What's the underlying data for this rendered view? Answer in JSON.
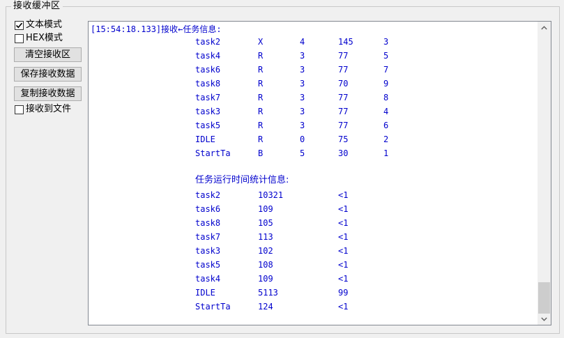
{
  "groupbox": {
    "title": "接收缓冲区"
  },
  "options": {
    "text_mode": {
      "label": "文本模式",
      "checked": true
    },
    "hex_mode": {
      "label": "HEX模式",
      "checked": false
    },
    "recv_to_file": {
      "label": "接收到文件",
      "checked": false
    }
  },
  "buttons": {
    "clear": "清空接收区",
    "save": "保存接收数据",
    "copy": "复制接收数据"
  },
  "receive": {
    "header": "[15:54:18.133]接收←任务信息:",
    "task_rows": [
      [
        "task2",
        "X",
        "4",
        "145",
        "3"
      ],
      [
        "task4",
        "R",
        "3",
        "77",
        "5"
      ],
      [
        "task6",
        "R",
        "3",
        "77",
        "7"
      ],
      [
        "task8",
        "R",
        "3",
        "70",
        "9"
      ],
      [
        "task7",
        "R",
        "3",
        "77",
        "8"
      ],
      [
        "task3",
        "R",
        "3",
        "77",
        "4"
      ],
      [
        "task5",
        "R",
        "3",
        "77",
        "6"
      ],
      [
        "IDLE",
        "R",
        "0",
        "75",
        "2"
      ],
      [
        "StartTa",
        "B",
        "5",
        "30",
        "1"
      ]
    ],
    "stats_header": "任务运行时间统计信息:",
    "stats_rows": [
      [
        "task2",
        "10321",
        "<1"
      ],
      [
        "task6",
        "109",
        "<1"
      ],
      [
        "task8",
        "105",
        "<1"
      ],
      [
        "task7",
        "113",
        "<1"
      ],
      [
        "task3",
        "102",
        "<1"
      ],
      [
        "task5",
        "108",
        "<1"
      ],
      [
        "task4",
        "109",
        "<1"
      ],
      [
        "IDLE",
        "5113",
        "99"
      ],
      [
        "StartTa",
        "124",
        "<1"
      ]
    ]
  },
  "icons": {
    "scroll_up": "chevron-up-icon",
    "scroll_down": "chevron-down-icon",
    "check": "checkmark-icon"
  },
  "colors": {
    "receive_text": "#0000cd",
    "background": "#f0f0f0"
  }
}
